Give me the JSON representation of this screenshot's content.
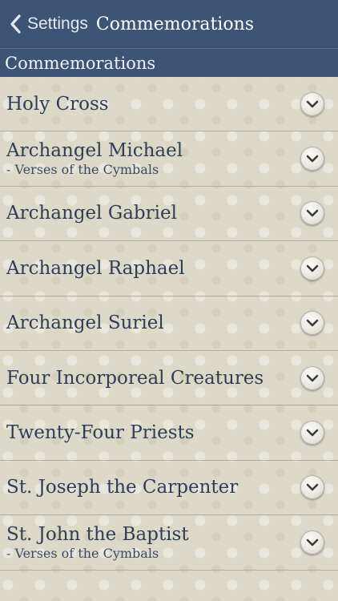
{
  "nav": {
    "back_label": "Settings",
    "title": "Commemorations"
  },
  "section": {
    "title": "Commemorations"
  },
  "items": [
    {
      "title": "Holy Cross",
      "subtitle": ""
    },
    {
      "title": "Archangel Michael",
      "subtitle": "- Verses of the Cymbals"
    },
    {
      "title": "Archangel Gabriel",
      "subtitle": ""
    },
    {
      "title": "Archangel Raphael",
      "subtitle": ""
    },
    {
      "title": "Archangel Suriel",
      "subtitle": ""
    },
    {
      "title": "Four Incorporeal Creatures",
      "subtitle": ""
    },
    {
      "title": "Twenty-Four Priests",
      "subtitle": ""
    },
    {
      "title": "St. Joseph the Carpenter",
      "subtitle": ""
    },
    {
      "title": "St. John the Baptist",
      "subtitle": "- Verses of the Cymbals"
    }
  ],
  "icons": {
    "back": "chevron-left-icon",
    "expand": "chevron-down-icon"
  },
  "colors": {
    "nav_background": "#3e5477",
    "list_text": "#2f3e55",
    "list_background": "#ddd9c8"
  }
}
